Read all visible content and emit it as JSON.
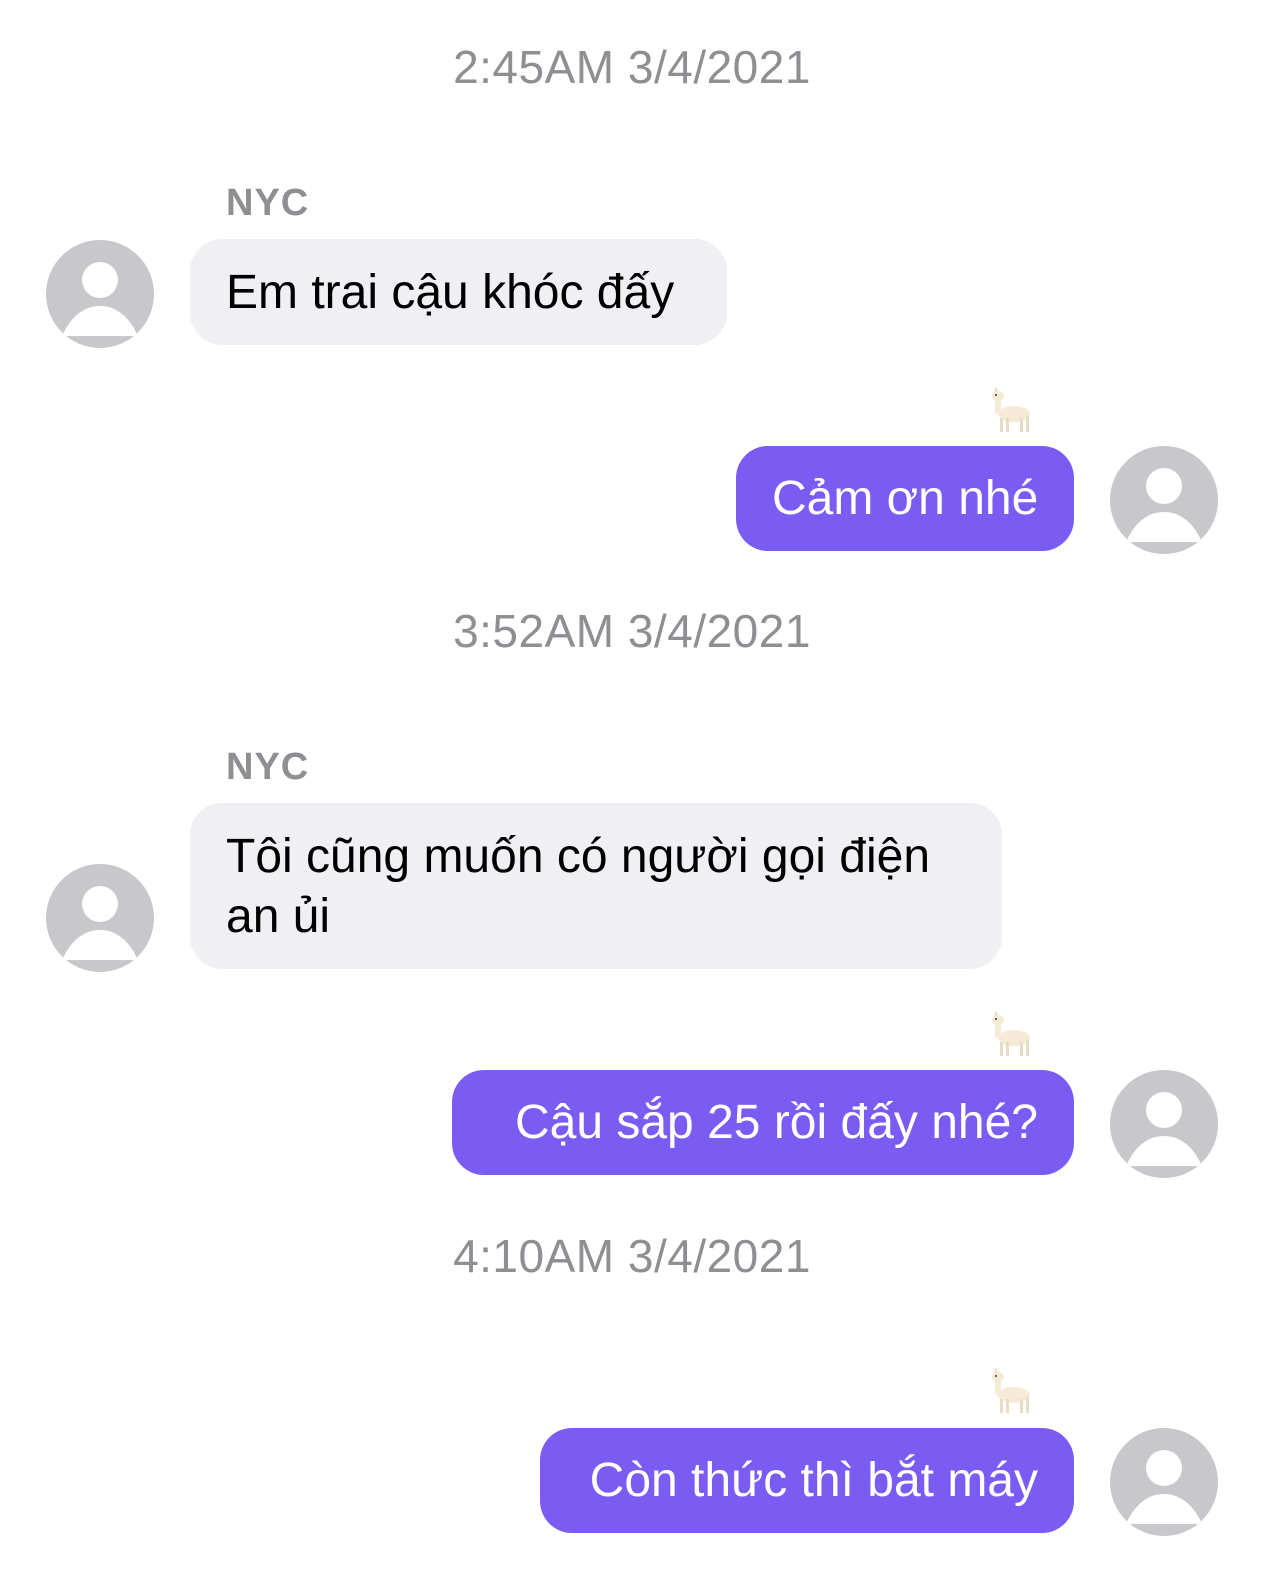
{
  "conversation": {
    "groups": [
      {
        "timestamp": "2:45AM 3/4/2021",
        "incoming": {
          "sender": "NYC",
          "text": "Em trai cậu khóc đấy"
        },
        "outgoing": {
          "text": "Cảm ơn nhé",
          "reaction": "llama-emoji"
        }
      },
      {
        "timestamp": "3:52AM 3/4/2021",
        "incoming": {
          "sender": "NYC",
          "line1": "Tôi cũng muốn có người gọi điện",
          "line2": "an ủi"
        },
        "outgoing": {
          "text": "Cậu sắp 25 rồi đấy nhé?",
          "reaction": "llama-emoji"
        }
      },
      {
        "timestamp": "4:10AM 3/4/2021",
        "outgoing": {
          "text": "Còn thức thì bắt máy",
          "reaction": "llama-emoji"
        }
      }
    ]
  },
  "colors": {
    "outgoing_bubble": "#7b5cf3",
    "incoming_bubble": "#efeff4",
    "timestamp_text": "#8e8e93",
    "avatar_bg": "#c7c7cc"
  }
}
